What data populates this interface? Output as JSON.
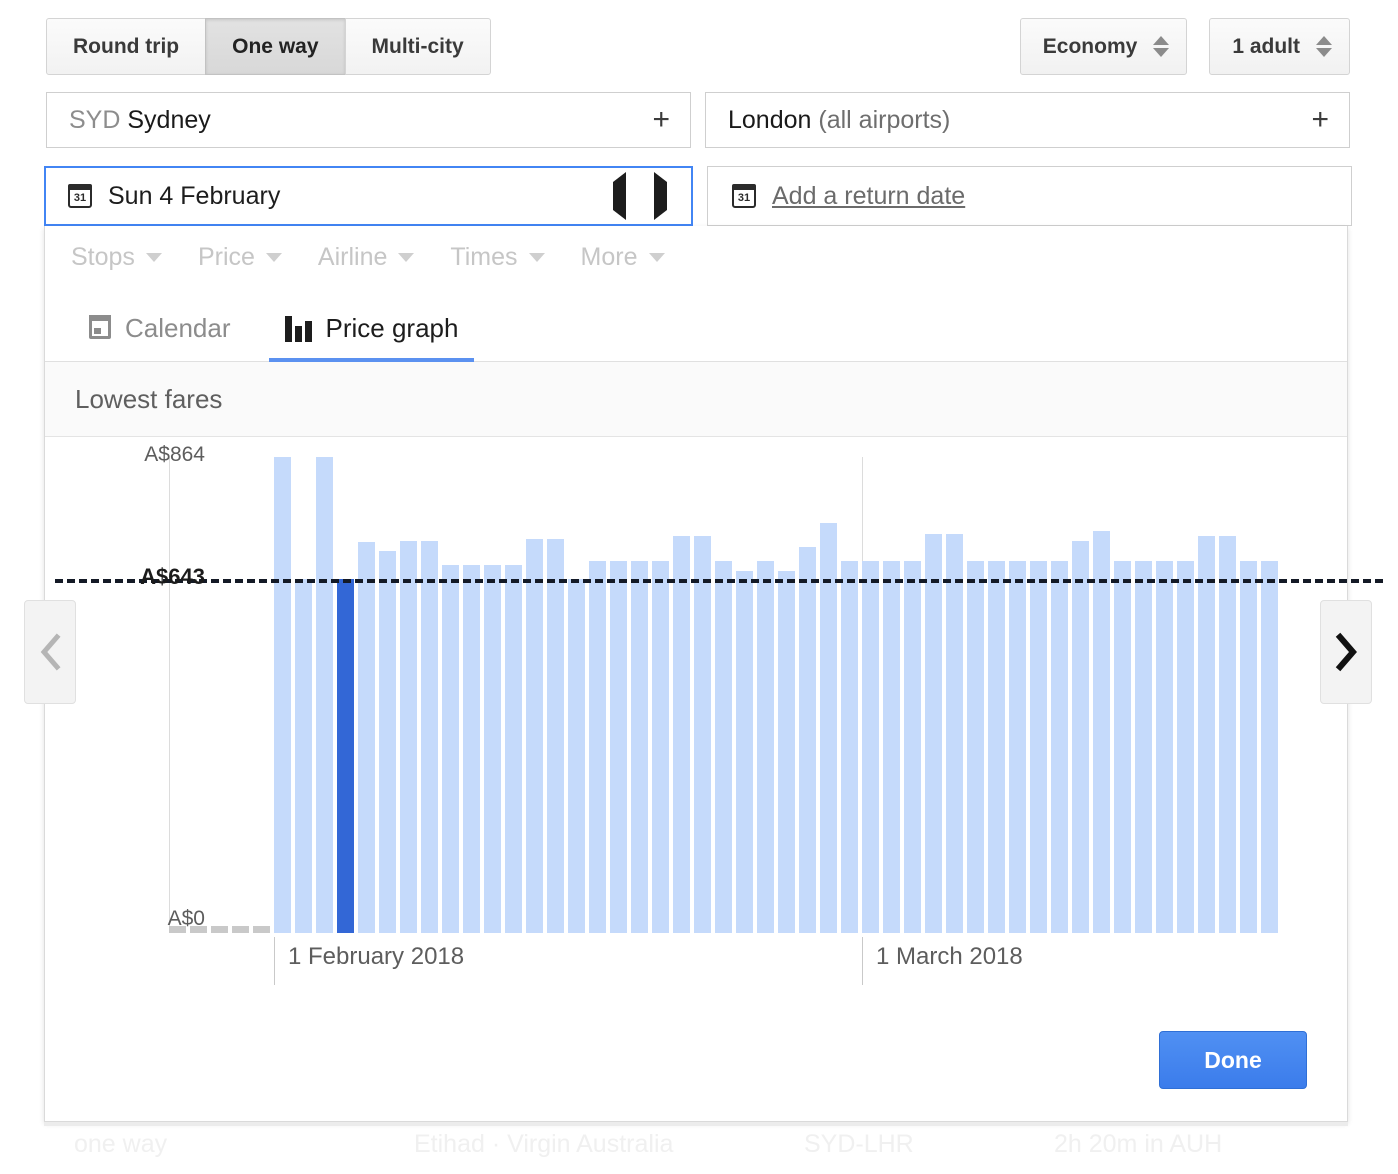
{
  "trip_types": [
    {
      "label": "Round trip",
      "active": false
    },
    {
      "label": "One way",
      "active": true
    },
    {
      "label": "Multi-city",
      "active": false
    }
  ],
  "options": {
    "cabin": "Economy",
    "passengers": "1 adult"
  },
  "places": {
    "origin_code": "SYD",
    "origin_city": "Sydney",
    "destination": "London",
    "destination_suffix": "(all airports)",
    "add_icon": "+"
  },
  "dates": {
    "calendar_icon_label": "31",
    "departure": "Sun 4 February",
    "return_placeholder": "Add a return date"
  },
  "filters": [
    {
      "label": "Stops"
    },
    {
      "label": "Price"
    },
    {
      "label": "Airline"
    },
    {
      "label": "Times"
    },
    {
      "label": "More"
    }
  ],
  "view_tabs": [
    {
      "label": "Calendar",
      "icon": "calendar-icon",
      "active": false
    },
    {
      "label": "Price graph",
      "icon": "bar-chart-icon",
      "active": true
    }
  ],
  "section_title": "Lowest fares",
  "done_label": "Done",
  "colors": {
    "bar": "#c5dafb",
    "bar_selected": "#3367d6",
    "bar_stub": "#c9c9c9",
    "accent": "#4285f4",
    "done_button": "#3b7ceb"
  },
  "ghost_row": {
    "duration_type": "one way",
    "airlines": "Etihad · Virgin Australia",
    "route": "SYD-LHR",
    "layover": "2h 20m in AUH"
  },
  "chart_data": {
    "type": "bar",
    "title": "Lowest fares",
    "xlabel": "",
    "ylabel": "",
    "currency": "A$",
    "ylim": [
      0,
      864
    ],
    "ytick_labels": [
      "A$864",
      "A$643",
      "A$0"
    ],
    "ytick_values": [
      864,
      643,
      0
    ],
    "grid": false,
    "reference_line": {
      "label": "A$643",
      "value": 643,
      "style": "dashed",
      "color": "#141a26"
    },
    "axis_labels": [
      {
        "text": "1 February 2018",
        "index": 5
      },
      {
        "text": "1 March 2018",
        "index": 33
      }
    ],
    "selected_index": 8,
    "selected_value": 643,
    "bar_kinds": [
      "stub",
      "stub",
      "stub",
      "stub",
      "stub",
      "bar",
      "bar",
      "bar",
      "selected",
      "bar",
      "bar",
      "bar",
      "bar",
      "bar",
      "bar",
      "bar",
      "bar",
      "bar",
      "bar",
      "bar",
      "bar",
      "bar",
      "bar",
      "bar",
      "bar",
      "bar",
      "bar",
      "bar",
      "bar",
      "bar",
      "bar",
      "bar",
      "bar",
      "bar",
      "bar",
      "bar",
      "bar",
      "bar",
      "bar",
      "bar",
      "bar",
      "bar",
      "bar",
      "bar",
      "bar",
      "bar",
      "bar",
      "bar",
      "bar",
      "bar",
      "bar",
      "bar",
      "bar"
    ],
    "values": [
      12,
      12,
      12,
      12,
      12,
      864,
      643,
      864,
      643,
      709,
      694,
      712,
      712,
      668,
      668,
      668,
      668,
      716,
      716,
      643,
      676,
      676,
      676,
      676,
      721,
      721,
      676,
      657,
      676,
      657,
      700,
      745,
      676,
      676,
      676,
      676,
      724,
      724,
      676,
      676,
      676,
      676,
      676,
      712,
      730,
      676,
      676,
      676,
      676,
      721,
      721,
      676,
      676
    ]
  }
}
